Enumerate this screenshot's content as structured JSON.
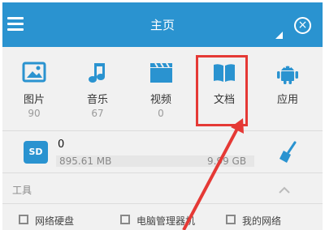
{
  "header": {
    "title": "主页"
  },
  "categories": [
    {
      "label": "图片",
      "count": "90",
      "icon": "image-icon"
    },
    {
      "label": "音乐",
      "count": "67",
      "icon": "music-icon"
    },
    {
      "label": "视频",
      "count": "0",
      "icon": "video-icon"
    },
    {
      "label": "文档",
      "count": "",
      "icon": "book-icon"
    },
    {
      "label": "应用",
      "count": "",
      "icon": "android-icon"
    }
  ],
  "storage": {
    "badge": "SD",
    "count": "0",
    "used": "895.61 MB",
    "total": "9.99 GB"
  },
  "tools": {
    "title": "工具",
    "items": [
      {
        "label": "网络硬盘"
      },
      {
        "label": "电脑管理器机"
      },
      {
        "label": "我的网络"
      }
    ]
  },
  "colors": {
    "header": "#2a93d0",
    "accent": "#2a93d0",
    "highlight": "#e53935"
  }
}
